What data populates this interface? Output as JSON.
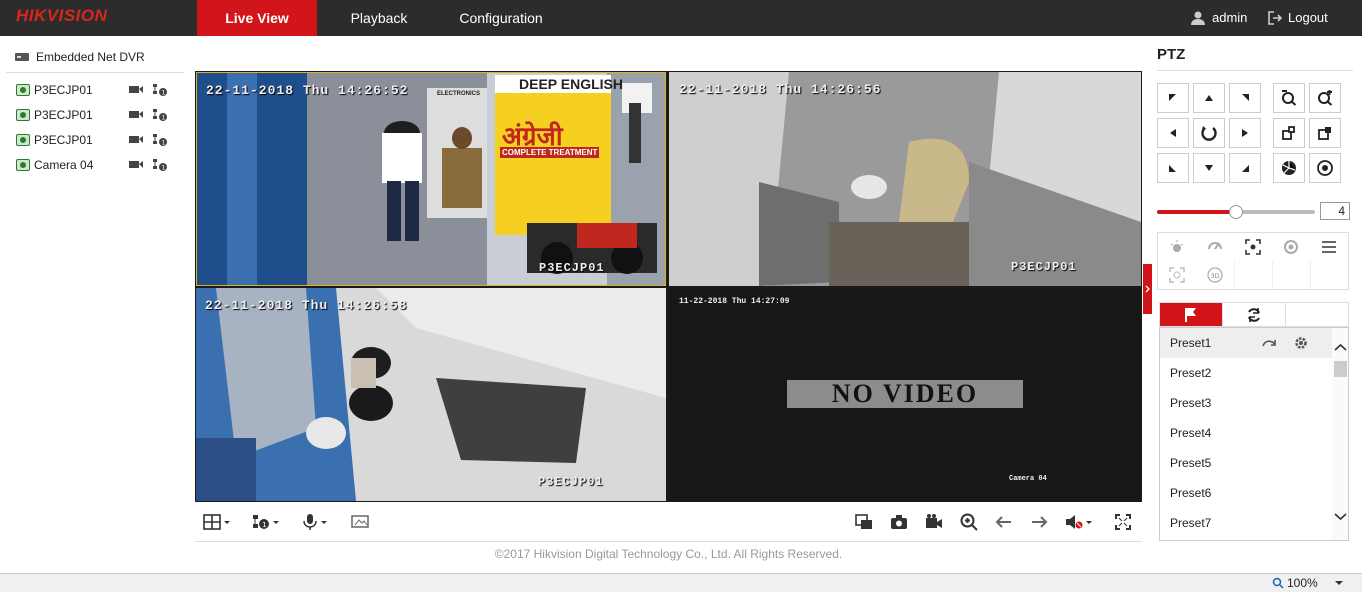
{
  "header": {
    "logo": "HIKVISION",
    "tabs": [
      {
        "label": "Live View"
      },
      {
        "label": "Playback"
      },
      {
        "label": "Configuration"
      }
    ],
    "user": "admin",
    "logout": "Logout"
  },
  "device_tree": {
    "dvr": "Embedded Net DVR",
    "cameras": [
      {
        "label": "P3ECJP01"
      },
      {
        "label": "P3ECJP01"
      },
      {
        "label": "P3ECJP01"
      },
      {
        "label": "Camera 04"
      }
    ]
  },
  "video": {
    "tiles": [
      {
        "timestamp": "22-11-2018 Thu 14:26:52",
        "camera_label": "P3ECJP01"
      },
      {
        "timestamp": "22-11-2018 Thu 14:26:56",
        "camera_label": "P3ECJP01"
      },
      {
        "timestamp": "22-11-2018 Thu 14:26:58",
        "camera_label": "P3ECJP01"
      },
      {
        "timestamp": "11-22-2018 Thu 14:27:09",
        "camera_label": "Camera 04",
        "overlay": "NO VIDEO"
      }
    ],
    "signs": {
      "deep_english": "DEEP ENGLISH",
      "angrezi": "अंग्रेजी",
      "complete": "COMPLETE TREATMENT",
      "electronics": "ELECTRONICS"
    }
  },
  "footer": "©2017 Hikvision Digital Technology Co., Ltd. All Rights Reserved.",
  "ptz": {
    "title": "PTZ",
    "speed": "4",
    "speed_level": 0.5,
    "presets": [
      "Preset1",
      "Preset2",
      "Preset3",
      "Preset4",
      "Preset5",
      "Preset6",
      "Preset7"
    ]
  },
  "status": {
    "zoom": "100%"
  },
  "colors": {
    "accent": "#d2151b",
    "header": "#2c2c2c"
  }
}
